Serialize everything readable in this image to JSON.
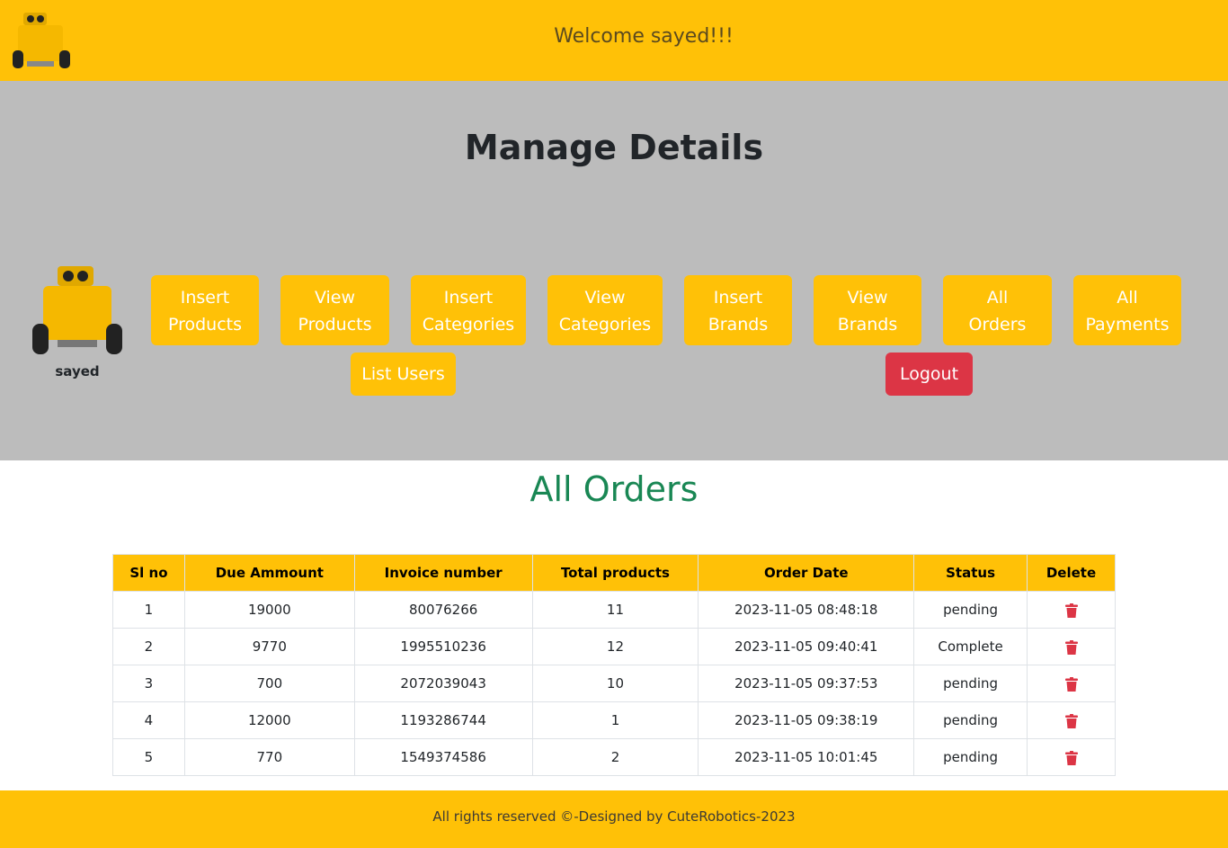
{
  "header": {
    "welcome": "Welcome sayed!!!"
  },
  "admin": {
    "title": "Manage Details",
    "username": "sayed",
    "buttons": [
      "Insert\nProducts",
      "View\nProducts",
      "Insert\nCategories",
      "View\nCategories",
      "Insert\nBrands",
      "View\nBrands",
      "All\nOrders",
      "All\nPayments"
    ],
    "list_users": "List Users",
    "logout": "Logout"
  },
  "orders": {
    "title": "All Orders",
    "columns": [
      "Sl no",
      "Due Ammount",
      "Invoice number",
      "Total products",
      "Order Date",
      "Status",
      "Delete"
    ],
    "rows": [
      [
        "1",
        "19000",
        "80076266",
        "11",
        "2023-11-05 08:48:18",
        "pending"
      ],
      [
        "2",
        "9770",
        "1995510236",
        "12",
        "2023-11-05 09:40:41",
        "Complete"
      ],
      [
        "3",
        "700",
        "2072039043",
        "10",
        "2023-11-05 09:37:53",
        "pending"
      ],
      [
        "4",
        "12000",
        "1193286744",
        "1",
        "2023-11-05 09:38:19",
        "pending"
      ],
      [
        "5",
        "770",
        "1549374586",
        "2",
        "2023-11-05 10:01:45",
        "pending"
      ]
    ],
    "delete_icon": "trash-icon"
  },
  "footer": {
    "text": "All rights reserved ©-Designed by CuteRobotics-2023"
  },
  "colors": {
    "accent": "#ffc107",
    "panel": "#bcbcbc",
    "danger": "#dc3545",
    "success": "#198754"
  }
}
